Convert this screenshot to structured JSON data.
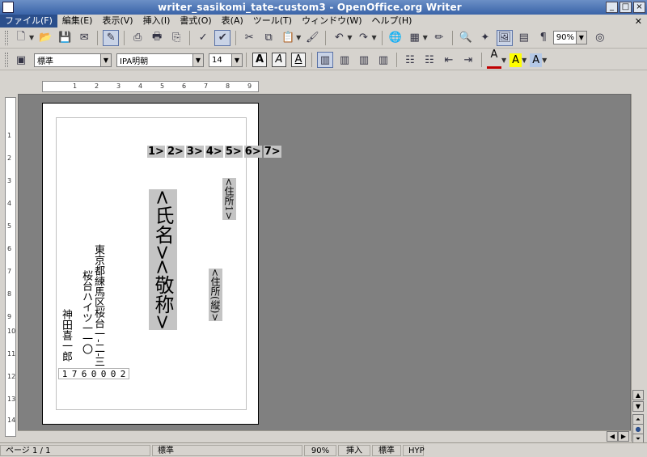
{
  "window": {
    "title": "writer_sasikomi_tate-custom3 - OpenOffice.org Writer"
  },
  "menu": [
    "ファイル(F)",
    "編集(E)",
    "表示(V)",
    "挿入(I)",
    "書式(O)",
    "表(A)",
    "ツール(T)",
    "ウィンドウ(W)",
    "ヘルプ(H)"
  ],
  "toolbar": {
    "zoom": "90%"
  },
  "format": {
    "style": "標準",
    "font": "IPA明朝",
    "size": "14",
    "bold": "A",
    "italic": "A",
    "underline": "A",
    "font_color": "A",
    "highlight": "A",
    "char_bg": "A"
  },
  "ruler_h": [
    "1",
    "2",
    "3",
    "4",
    "5",
    "6",
    "7",
    "8",
    "9"
  ],
  "ruler_v": [
    "1",
    "2",
    "3",
    "4",
    "5",
    "6",
    "7",
    "8",
    "9",
    "10",
    "11",
    "12",
    "13",
    "14"
  ],
  "document": {
    "numbers": [
      "1",
      "2",
      "3",
      "4",
      "5",
      "6",
      "7"
    ],
    "address1": "<住所1>",
    "name": "<氏名>",
    "honorific": "<敬称>",
    "address_vertical": "<住所(縦)>",
    "sender_address1": "東京都練馬区桜台一-二-三",
    "sender_address2": "桜台ハイツ一一〇",
    "sender_name": "神田喜一郎",
    "sender_zip": [
      "1",
      "7",
      "6",
      "0",
      "0",
      "0",
      "2"
    ]
  },
  "status": {
    "page": "ページ 1 / 1",
    "style": "標準",
    "zoom": "90%",
    "mode": "挿入",
    "selection": "標準",
    "hyp": "HYP"
  }
}
